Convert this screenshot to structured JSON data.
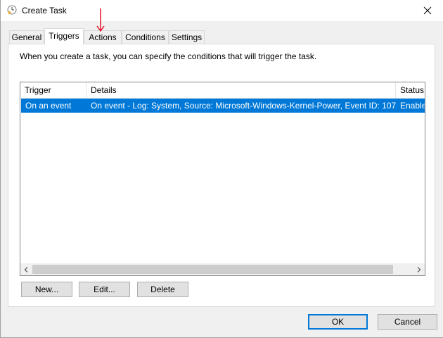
{
  "window": {
    "title": "Create Task",
    "icon": "clock-icon",
    "close_icon": "close-icon"
  },
  "tabs": [
    {
      "label": "General",
      "active": false
    },
    {
      "label": "Triggers",
      "active": true
    },
    {
      "label": "Actions",
      "active": false
    },
    {
      "label": "Conditions",
      "active": false
    },
    {
      "label": "Settings",
      "active": false
    }
  ],
  "triggers": {
    "description": "When you create a task, you can specify the conditions that will trigger the task.",
    "columns": [
      "Trigger",
      "Details",
      "Status"
    ],
    "rows": [
      {
        "trigger": "On an event",
        "details": "On event - Log: System, Source: Microsoft-Windows-Kernel-Power, Event ID: 107",
        "status": "Enabled",
        "selected": true
      }
    ],
    "buttons": {
      "new_label": "New...",
      "edit_label": "Edit...",
      "delete_label": "Delete"
    }
  },
  "footer": {
    "ok_label": "OK",
    "cancel_label": "Cancel"
  },
  "colors": {
    "selection": "#0078d7",
    "annotation_arrow": "#e81123",
    "panel": "#ffffff",
    "window_bg": "#f0f0f0"
  },
  "annotation": {
    "icon": "red-arrow-down-icon"
  }
}
